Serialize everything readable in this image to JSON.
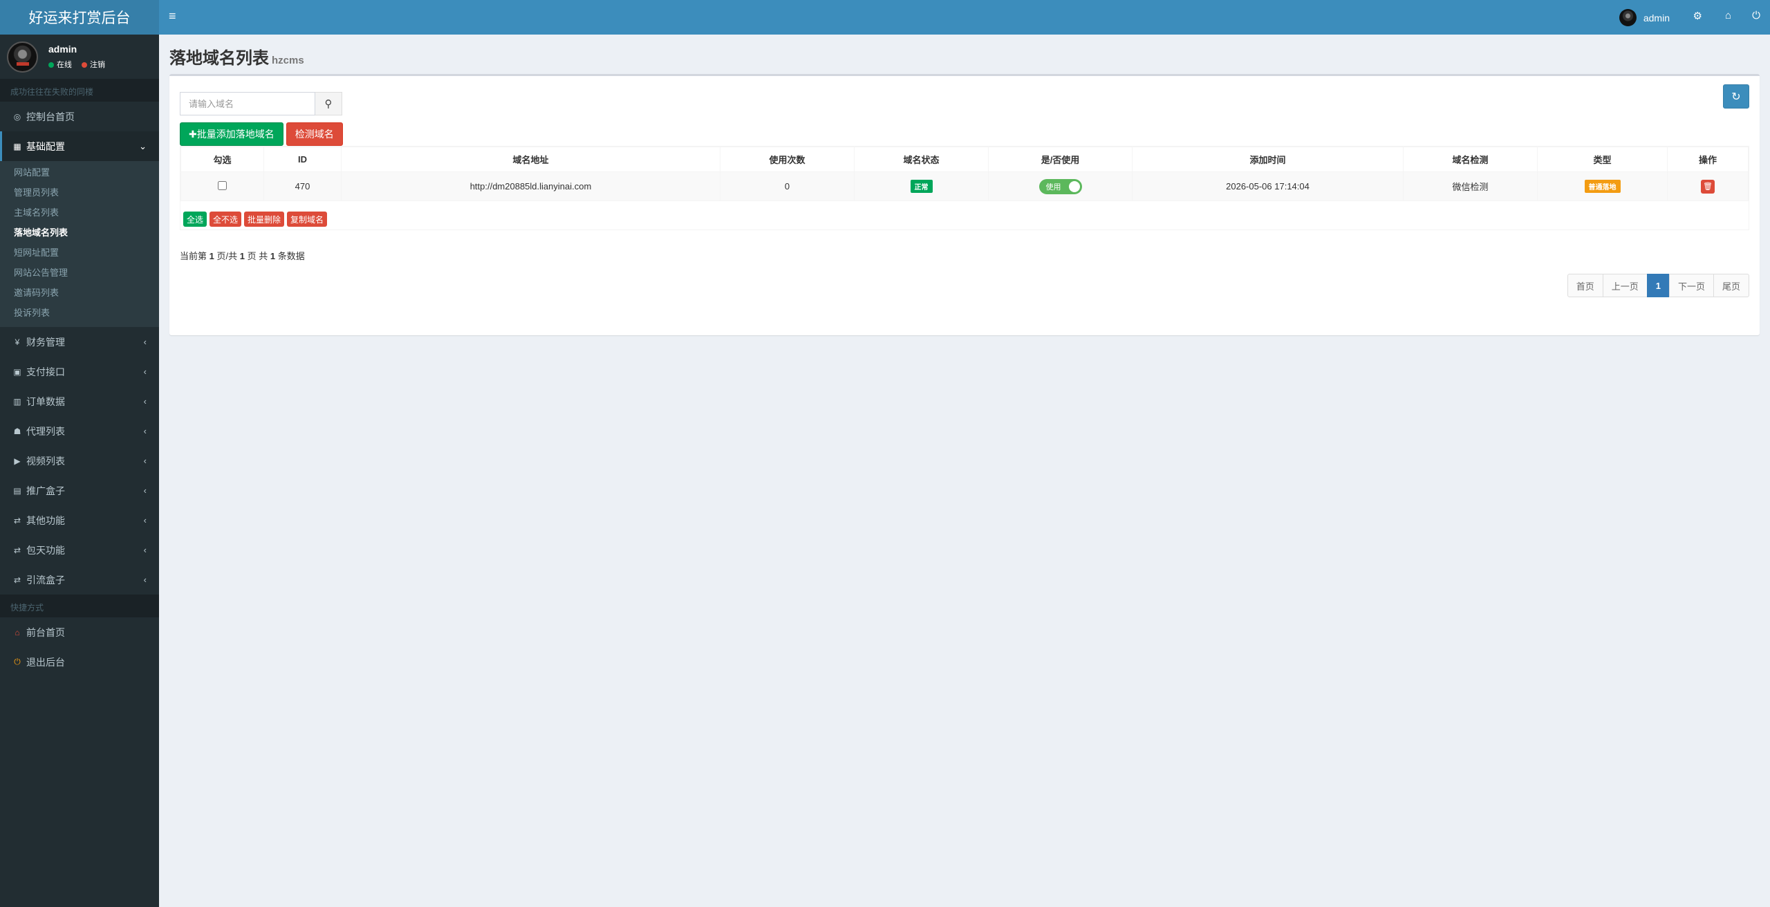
{
  "sidebar": {
    "logo": "好运来打赏后台",
    "user": {
      "name": "admin",
      "status_online": "在线",
      "status_logout": "注销"
    },
    "motto": "成功往往在失败的同楼",
    "menu": [
      {
        "label": "控制台首页",
        "icon": "dashboard-icon",
        "glyph": "◎"
      },
      {
        "label": "基础配置",
        "icon": "th-icon",
        "glyph": "▦",
        "active": true,
        "children": [
          "网站配置",
          "管理员列表",
          "主域名列表",
          "落地域名列表",
          "短网址配置",
          "网站公告管理",
          "邀请码列表",
          "投诉列表"
        ]
      },
      {
        "label": "财务管理",
        "icon": "yen-icon",
        "glyph": "¥"
      },
      {
        "label": "支付接口",
        "icon": "payment-icon",
        "glyph": "▣"
      },
      {
        "label": "订单数据",
        "icon": "bar-chart-icon",
        "glyph": "▥"
      },
      {
        "label": "代理列表",
        "icon": "users-icon",
        "glyph": "☗"
      },
      {
        "label": "视频列表",
        "icon": "video-icon",
        "glyph": "▶"
      },
      {
        "label": "推广盒子",
        "icon": "table-icon",
        "glyph": "▤"
      },
      {
        "label": "其他功能",
        "icon": "retweet-icon",
        "glyph": "⇄"
      },
      {
        "label": "包天功能",
        "icon": "retweet-icon",
        "glyph": "⇄"
      },
      {
        "label": "引流盒子",
        "icon": "retweet-icon",
        "glyph": "⇄"
      }
    ],
    "quick_header": "快捷方式",
    "quick": [
      {
        "label": "前台首页",
        "icon": "home-icon",
        "glyph": "⌂",
        "color": "#dd4b39"
      },
      {
        "label": "退出后台",
        "icon": "power-icon",
        "glyph": "⏻",
        "color": "#f39c12"
      }
    ]
  },
  "topbar": {
    "menu_glyph": "≡",
    "username": "admin",
    "icons": {
      "share": "⚙",
      "home": "⌂",
      "power": "⏻"
    }
  },
  "page": {
    "title": "落地域名列表",
    "subtitle": "hzcms"
  },
  "toolbar": {
    "search_placeholder": "请输入域名",
    "search_glyph": "⚲",
    "refresh_glyph": "↻",
    "batch_add": "✚批量添加落地域名",
    "check_domain": "检测域名"
  },
  "table": {
    "headers": [
      "勾选",
      "ID",
      "域名地址",
      "使用次数",
      "域名状态",
      "是/否使用",
      "添加时间",
      "域名检测",
      "类型",
      "操作"
    ],
    "rows": [
      {
        "id": "470",
        "url": "http://dm20885ld.lianyinai.com",
        "count": "0",
        "status": "正常",
        "use": "使用",
        "time": "2026-05-06 17:14:04",
        "check": "微信检测",
        "type": "普通落地",
        "delete_glyph": "🗑"
      }
    ]
  },
  "bulk": {
    "select_all": "全选",
    "select_none": "全不选",
    "batch_delete": "批量删除",
    "copy": "复制域名"
  },
  "pager": {
    "prefix": "当前第",
    "current": "1",
    "mid1": "页/共",
    "total_pages": "1",
    "mid2": "页 共",
    "total": "1",
    "suffix": "条数据",
    "first": "首页",
    "prev": "上一页",
    "page": "1",
    "next": "下一页",
    "last": "尾页"
  },
  "colors": {
    "primary": "#3c8dbc",
    "success": "#00a65a",
    "danger": "#dd4b39",
    "warning": "#f39c12",
    "sidebar": "#222d32"
  }
}
